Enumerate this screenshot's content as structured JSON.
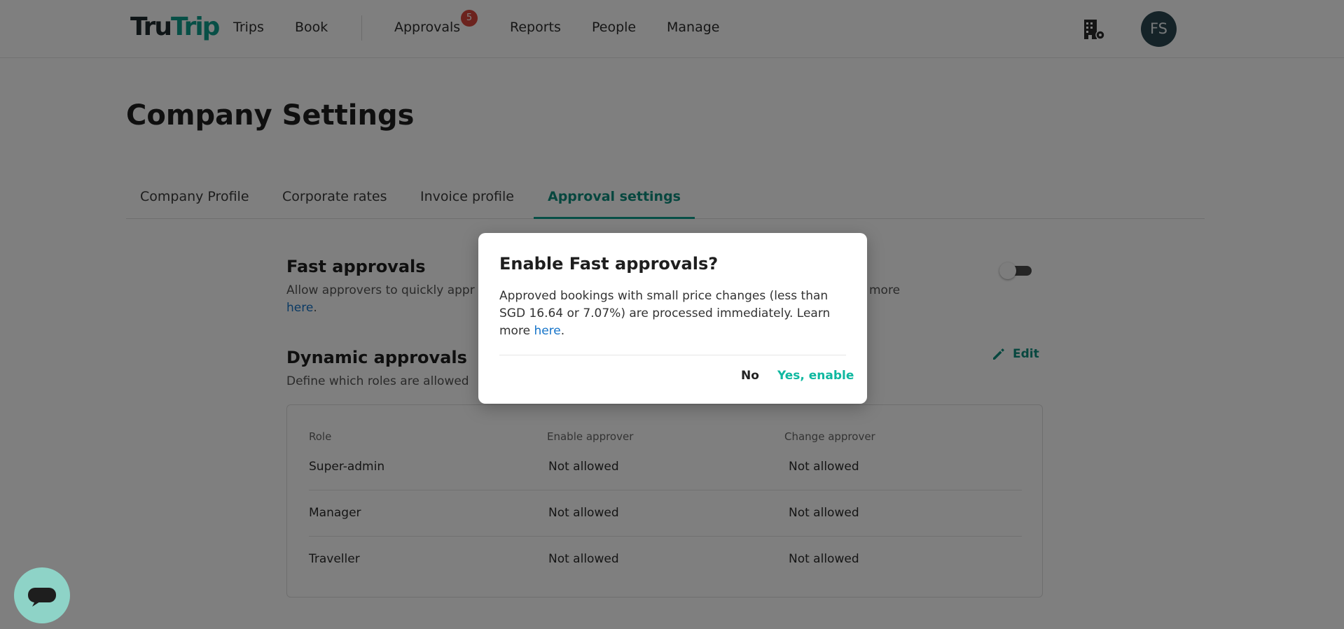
{
  "header": {
    "logo_part1": "Tru",
    "logo_part2": "Trip",
    "nav": {
      "trips": "Trips",
      "book": "Book",
      "approvals": "Approvals",
      "reports": "Reports",
      "people": "People",
      "manage": "Manage"
    },
    "approvals_badge": "5",
    "company_icon": "building-gear-icon",
    "avatar_initials": "FS"
  },
  "page": {
    "title": "Company Settings",
    "tabs": [
      "Company Profile",
      "Corporate rates",
      "Invoice profile",
      "Approval settings"
    ],
    "active_tab": "Approval settings"
  },
  "fast_approvals": {
    "title": "Fast approvals",
    "desc_start": "Allow approvers to quickly appr",
    "desc_end": "more",
    "link": "here",
    "after_link": ".",
    "toggle_on": false
  },
  "dynamic_approvals": {
    "title": "Dynamic approvals",
    "desc": "Define which roles are allowed",
    "edit_label": "Edit",
    "edit_icon": "pencil-icon",
    "table": {
      "headers": [
        "Role",
        "Enable approver",
        "Change approver"
      ],
      "rows": [
        [
          "Super-admin",
          "Not allowed",
          "Not allowed"
        ],
        [
          "Manager",
          "Not allowed",
          "Not allowed"
        ],
        [
          "Traveller",
          "Not allowed",
          "Not allowed"
        ]
      ]
    }
  },
  "modal": {
    "title": "Enable Fast approvals?",
    "body_text": "Approved bookings with small price changes (less than SGD 16.64 or 7.07%) are processed immediately. Learn more ",
    "link": "here",
    "after_link": ".",
    "no_label": "No",
    "yes_label": "Yes, enable"
  },
  "chat": {
    "icon": "chat-bubble-icon"
  },
  "colors": {
    "brand_teal": "#0f9e8c",
    "accent_link": "#1674c9",
    "badge_red": "#d9473c",
    "avatar_bg": "#2b4650"
  }
}
